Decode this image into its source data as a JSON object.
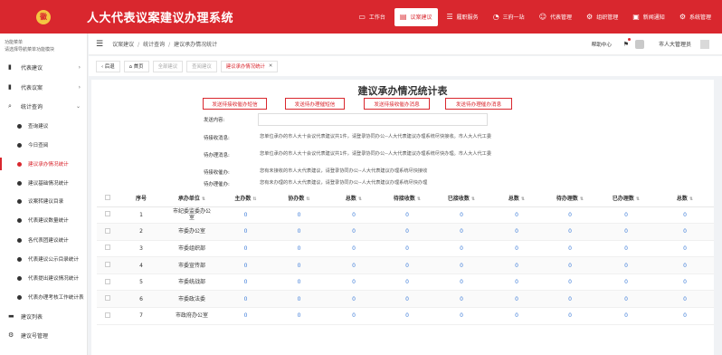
{
  "app": {
    "logo_text": "徽",
    "title": "人大代表议案建议办理系统"
  },
  "topnav": [
    {
      "icon": "▭",
      "label": "工作台"
    },
    {
      "icon": "▤",
      "label": "议案建议"
    },
    {
      "icon": "☰",
      "label": "履职服务"
    },
    {
      "icon": "◔",
      "label": "三府一站"
    },
    {
      "icon": "☺",
      "label": "代表管理"
    },
    {
      "icon": "⚙",
      "label": "组织管理"
    },
    {
      "icon": "▣",
      "label": "新闻通知"
    },
    {
      "icon": "⚙",
      "label": "系统管理"
    }
  ],
  "sidebar": {
    "header_line1": "功能菜单",
    "header_line2": "请选择导航菜单功能模块",
    "items": [
      {
        "icon": "▮",
        "label": "代表建议",
        "arrow": "›"
      },
      {
        "icon": "▮",
        "label": "代表议案",
        "arrow": "›"
      },
      {
        "icon": "⌕",
        "label": "统计查询",
        "arrow": "⌄"
      },
      {
        "icon": "▬",
        "label": "建议列表"
      },
      {
        "icon": "⚙",
        "label": "建议号管理"
      }
    ],
    "sub_items": [
      "查询建议",
      "今日查阅",
      "建议承办情况统计",
      "建议基础情况统计",
      "议案转建议目录",
      "代表建议数量统计",
      "各代表团建议统计",
      "代表建议公示目录统计",
      "代表提出建议情况统计",
      "代表办理考核工作统计表"
    ]
  },
  "header": {
    "crumbs": [
      "议案建议",
      "统计查询",
      "建议承办情况统计"
    ],
    "help": "帮助中心",
    "username": "市人大管理员"
  },
  "tabs": {
    "back": "‹ 后退",
    "home": "⌂ 首页",
    "t1": "全部建议",
    "t2": "查阅建议",
    "active": "建议承办情况统计",
    "close": "✕"
  },
  "report": {
    "title": "建议承办情况统计表",
    "buttons": [
      "发送待接收催办短信",
      "发送待办理催短信",
      "发送待接收催办消息",
      "发送待办理催办消息"
    ],
    "send_label": "发送内容:",
    "info": [
      {
        "label": "待接收消息:",
        "text": "您单位承办的市人大十会议代表建议共1件，请登录协同办公--人大代表建议办理系统尽快接收。市人大人代工委"
      },
      {
        "label": "待办理消息:",
        "text": "您单位承办的市人大十会议代表建议共1件，请登录协同办公--人大代表建议办理系统尽快办理。市人大人代工委"
      },
      {
        "label": "待接收催办:",
        "text": "您有未接收的市人大代表建议，请登录协同办公--人大代表建议办理系统尽快接收"
      },
      {
        "label": "待办理催办:",
        "text": "您有未办理的市人大代表建议，请登录协同办公--人大代表建议办理系统尽快办理"
      }
    ]
  },
  "table": {
    "headers": [
      "序号",
      "承办单位",
      "主办数",
      "协办数",
      "总数",
      "待接收数",
      "已接收数",
      "总数",
      "待办理数",
      "已办理数",
      "总数"
    ],
    "rows": [
      [
        "1",
        "市纪委监委办公室",
        "0",
        "0",
        "0",
        "0",
        "0",
        "0",
        "0",
        "0",
        "0"
      ],
      [
        "2",
        "市委办公室",
        "0",
        "0",
        "0",
        "0",
        "0",
        "0",
        "0",
        "0",
        "0"
      ],
      [
        "3",
        "市委组织部",
        "0",
        "0",
        "0",
        "0",
        "0",
        "0",
        "0",
        "0",
        "0"
      ],
      [
        "4",
        "市委宣传部",
        "0",
        "0",
        "0",
        "0",
        "0",
        "0",
        "0",
        "0",
        "0"
      ],
      [
        "5",
        "市委统战部",
        "0",
        "0",
        "0",
        "0",
        "0",
        "0",
        "0",
        "0",
        "0"
      ],
      [
        "6",
        "市委政法委",
        "0",
        "0",
        "0",
        "0",
        "0",
        "0",
        "0",
        "0",
        "0"
      ],
      [
        "7",
        "市政府办公室",
        "0",
        "0",
        "0",
        "0",
        "0",
        "0",
        "0",
        "0",
        "0"
      ]
    ]
  },
  "colors": {
    "brand": "#d9272e",
    "link": "#3b7bd8"
  }
}
